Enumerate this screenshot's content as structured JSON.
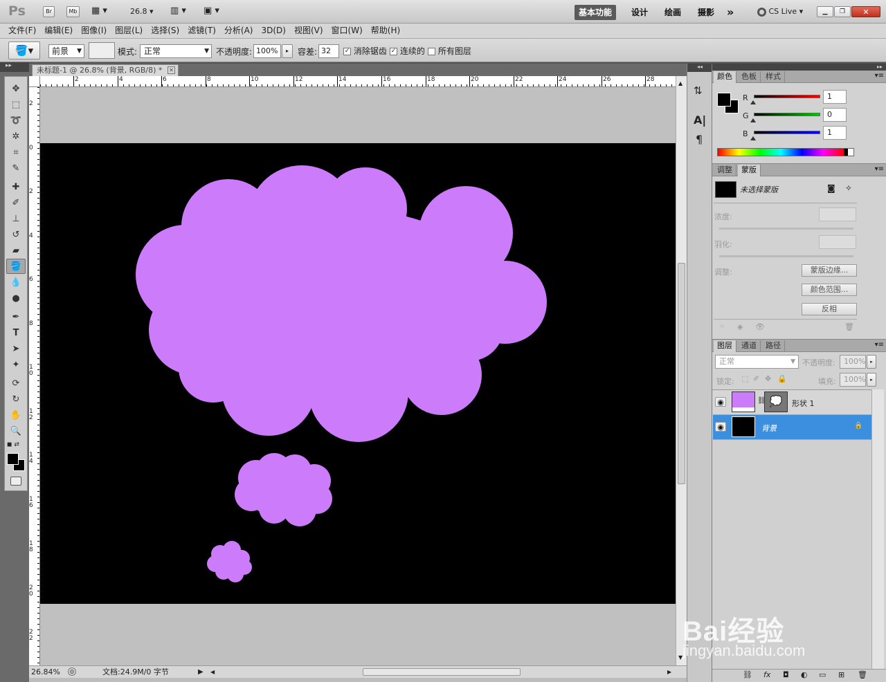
{
  "app": {
    "logo": "Ps",
    "bridge": "Br",
    "mini_bridge": "Mb",
    "zoom": "26.8",
    "workspace_active": "基本功能",
    "workspaces": [
      "设计",
      "绘画",
      "摄影"
    ],
    "more": "»",
    "cslive": "CS Live"
  },
  "menus": [
    "文件(F)",
    "编辑(E)",
    "图像(I)",
    "图层(L)",
    "选择(S)",
    "滤镜(T)",
    "分析(A)",
    "3D(D)",
    "视图(V)",
    "窗口(W)",
    "帮助(H)"
  ],
  "options": {
    "fill_source": "前景",
    "mode_label": "模式:",
    "mode_value": "正常",
    "opacity_label": "不透明度:",
    "opacity_value": "100%",
    "tolerance_label": "容差:",
    "tolerance_value": "32",
    "antialias": "消除锯齿",
    "contiguous": "连续的",
    "all_layers": "所有图层"
  },
  "document": {
    "tab_title": "未标题-1 @ 26.8% (背景, RGB/8) *",
    "hruler_ticks": [
      "2",
      "4",
      "6",
      "8",
      "10",
      "12",
      "14",
      "16",
      "18",
      "20",
      "22",
      "24",
      "26",
      "28"
    ],
    "vruler_ticks": [
      "2",
      "0",
      "2",
      "4",
      "6",
      "8",
      "10",
      "12",
      "14",
      "16",
      "18",
      "20",
      "22"
    ],
    "shape_color": "#cc7bfa",
    "background_color": "#000000"
  },
  "status": {
    "zoom": "26.84%",
    "doc_info": "文档:24.9M/0 字节"
  },
  "color_panel": {
    "tabs": [
      "颜色",
      "色板",
      "样式"
    ],
    "r_label": "R",
    "g_label": "G",
    "b_label": "B",
    "r": "1",
    "g": "0",
    "b": "1"
  },
  "masks_panel": {
    "tabs": [
      "调整",
      "蒙版"
    ],
    "title": "未选择蒙版",
    "density": "浓度:",
    "feather": "羽化:",
    "refine": "调整:",
    "btn_edge": "蒙版边缘...",
    "btn_range": "颜色范围...",
    "btn_invert": "反相"
  },
  "layers_panel": {
    "tabs": [
      "图层",
      "通道",
      "路径"
    ],
    "blend": "正常",
    "opacity_label": "不透明度:",
    "opacity": "100%",
    "lock_label": "锁定:",
    "fill_label": "填充:",
    "fill": "100%",
    "layers": [
      {
        "name": "形状 1"
      },
      {
        "name": "背景"
      }
    ]
  },
  "watermark": {
    "brand": "Bai经验",
    "url": "jingyan.baidu.com"
  }
}
